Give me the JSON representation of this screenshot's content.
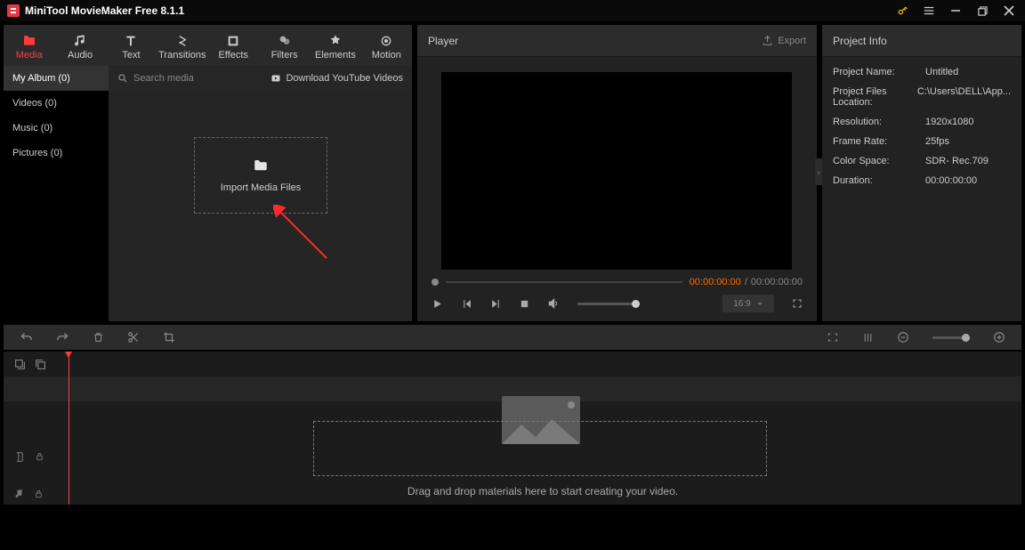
{
  "app": {
    "title": "MiniTool MovieMaker Free 8.1.1"
  },
  "tabs": [
    {
      "label": "Media"
    },
    {
      "label": "Audio"
    },
    {
      "label": "Text"
    },
    {
      "label": "Transitions"
    },
    {
      "label": "Effects"
    },
    {
      "label": "Filters"
    },
    {
      "label": "Elements"
    },
    {
      "label": "Motion"
    }
  ],
  "albums": [
    {
      "label": "My Album (0)"
    },
    {
      "label": "Videos (0)"
    },
    {
      "label": "Music (0)"
    },
    {
      "label": "Pictures (0)"
    }
  ],
  "search": {
    "placeholder": "Search media",
    "download": "Download YouTube Videos"
  },
  "import": {
    "label": "Import Media Files"
  },
  "player": {
    "title": "Player",
    "export": "Export",
    "time_current": "00:00:00:00",
    "time_sep": " / ",
    "time_total": "00:00:00:00",
    "aspect": "16:9"
  },
  "project": {
    "title": "Project Info",
    "rows": [
      {
        "k": "Project Name:",
        "v": "Untitled"
      },
      {
        "k": "Project Files Location:",
        "v": "C:\\Users\\DELL\\App..."
      },
      {
        "k": "Resolution:",
        "v": "1920x1080"
      },
      {
        "k": "Frame Rate:",
        "v": "25fps"
      },
      {
        "k": "Color Space:",
        "v": "SDR- Rec.709"
      },
      {
        "k": "Duration:",
        "v": "00:00:00:00"
      }
    ]
  },
  "timeline": {
    "hint": "Drag and drop materials here to start creating your video."
  }
}
